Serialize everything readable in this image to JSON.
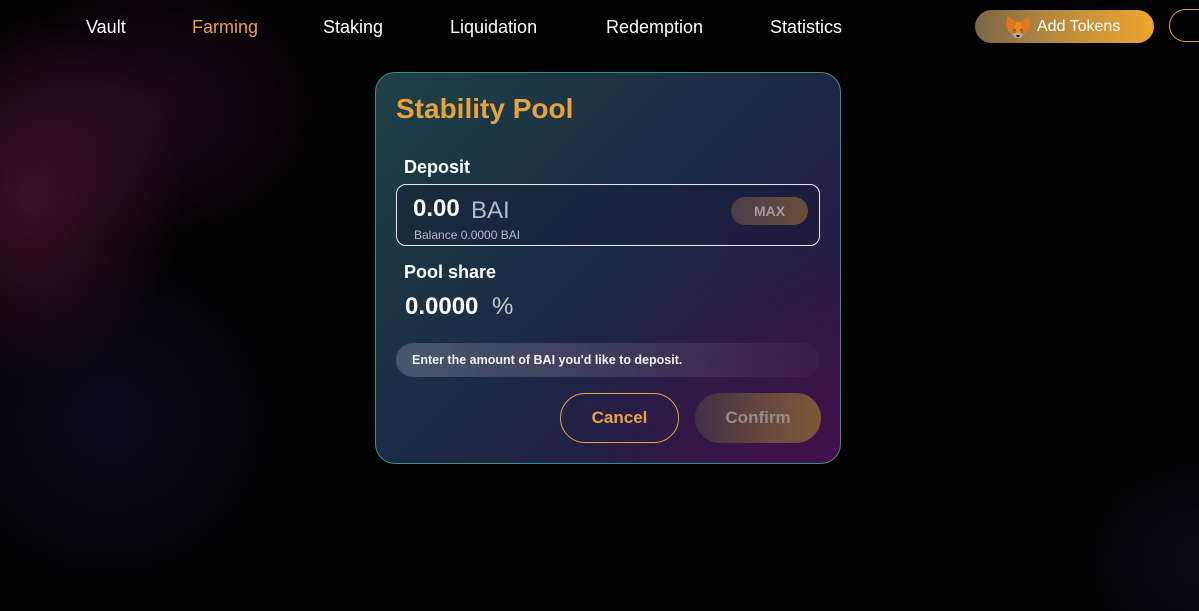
{
  "nav": {
    "items": [
      {
        "label": "Vault",
        "active": false
      },
      {
        "label": "Farming",
        "active": true
      },
      {
        "label": "Staking",
        "active": false
      },
      {
        "label": "Liquidation",
        "active": false
      },
      {
        "label": "Redemption",
        "active": false
      },
      {
        "label": "Statistics",
        "active": false
      }
    ],
    "add_tokens_label": "Add Tokens",
    "add_tokens_icon": "metamask-fox-icon"
  },
  "stability_pool": {
    "title": "Stability Pool",
    "deposit": {
      "label": "Deposit",
      "amount_placeholder": "0.00",
      "token": "BAI",
      "balance_text": "Balance 0.0000 BAI",
      "max_label": "MAX"
    },
    "pool_share": {
      "label": "Pool share",
      "value": "0.0000",
      "unit": "%"
    },
    "hint": "Enter the amount of BAI you'd like to deposit.",
    "cancel_label": "Cancel",
    "confirm_label": "Confirm"
  },
  "colors": {
    "accent": "#e9a23b",
    "card_border": "#3c8c86",
    "background": "#000000"
  }
}
